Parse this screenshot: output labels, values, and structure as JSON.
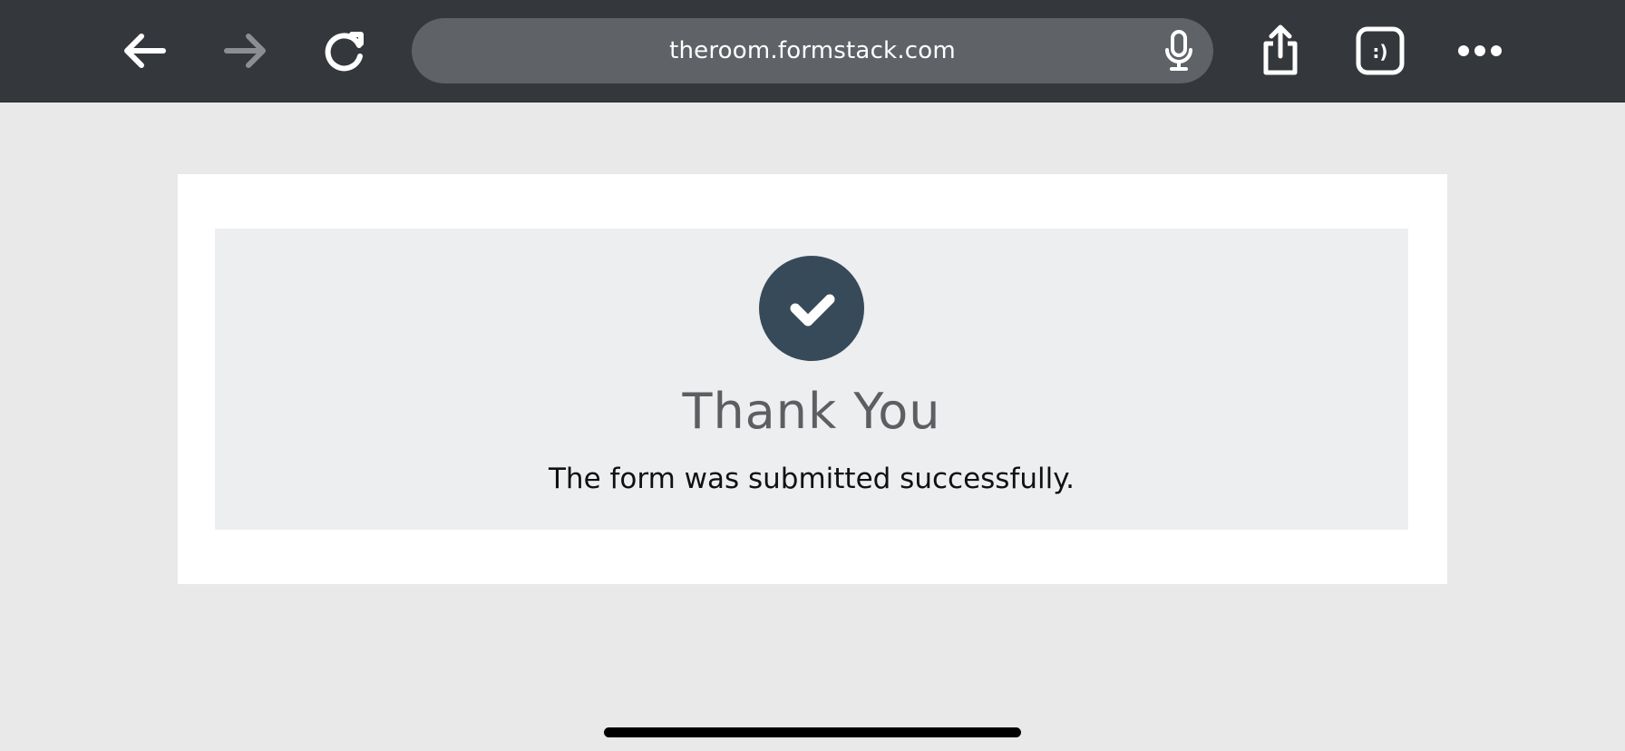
{
  "browser": {
    "url": "theroom.formstack.com",
    "icons": {
      "back": "arrow-left-icon",
      "forward": "arrow-right-icon",
      "reload": "reload-icon",
      "mic": "microphone-icon",
      "share": "share-icon",
      "tabs": "tabs-icon",
      "more": "more-icon"
    },
    "tab_badge": ":)"
  },
  "confirmation": {
    "title": "Thank You",
    "message": "The form was submitted successfully.",
    "icon": "checkmark-circle-icon",
    "accent_color": "#374a59"
  },
  "colors": {
    "toolbar": "#34383d",
    "address_bar": "#5f6367",
    "page_background": "#e9e9e9",
    "panel_background": "#edeef0"
  }
}
